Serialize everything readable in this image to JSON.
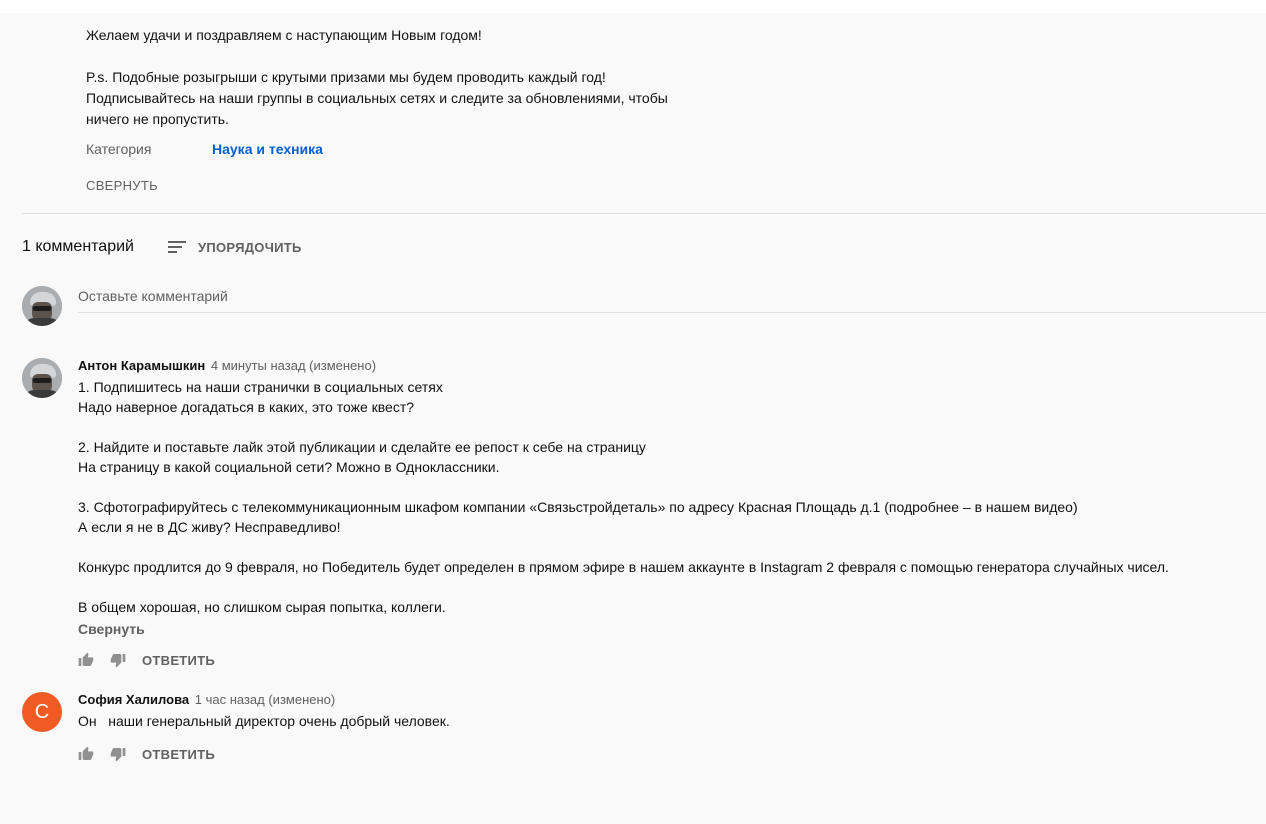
{
  "description": {
    "line1": "Желаем удачи и поздравляем с наступающим Новым годом!",
    "ps_line1": "P.s. Подобные розыгрыши с крутыми призами мы будем проводить каждый год!",
    "ps_line2": "Подписывайтесь на наши группы в социальных сетях и следите за обновлениями, чтобы",
    "ps_line3": "ничего не пропустить.",
    "category_label": "Категория",
    "category_value": "Наука и техника",
    "collapse_label": "СВЕРНУТЬ"
  },
  "comments_header": {
    "count_label": "1 комментарий",
    "sort_label": "УПОРЯДОЧИТЬ"
  },
  "add_comment": {
    "placeholder": "Оставьте комментарий"
  },
  "comments": [
    {
      "author": "Антон Карамышкин",
      "time": "4 минуты назад (изменено)",
      "lines": [
        "1. Подпишитесь на наши странички в социальных сетях",
        "Надо наверное догадаться в каких, это тоже квест?",
        "2. Найдите и поставьте лайк этой публикации и сделайте ее репост к себе на страницу",
        "На страницу в какой социальной сети? Можно в Одноклассники.",
        "3. Сфотографируйтесь с телекоммуникационным шкафом компании «Связьстройдеталь» по адресу Красная Площадь д.1 (подробнее – в нашем видео)",
        "А если я не в ДС живу? Несправедливо!",
        "Конкурс продлится до 9 февраля, но Победитель будет определен в прямом эфире в нашем аккаунте в Instagram 2 февраля с помощью генератора случайных чисел.",
        "В общем хорошая, но слишком сырая попытка, коллеги."
      ],
      "collapse_label": "Свернуть",
      "reply_label": "ОТВЕТИТЬ"
    },
    {
      "author": "София Халилова",
      "avatar_letter": "С",
      "avatar_color": "#ef5b23",
      "time": "1 час назад (изменено)",
      "text": "Он   наши генеральный директор очень добрый человек.",
      "reply_label": "ОТВЕТИТЬ"
    }
  ],
  "icons": {
    "like": "thumbs-up-icon",
    "dislike": "thumbs-down-icon",
    "sort": "sort-icon"
  },
  "colors": {
    "link": "#065fd4",
    "secondary_text": "#606060",
    "avatar_orange": "#ef5b23",
    "background": "#f9f9f9"
  }
}
